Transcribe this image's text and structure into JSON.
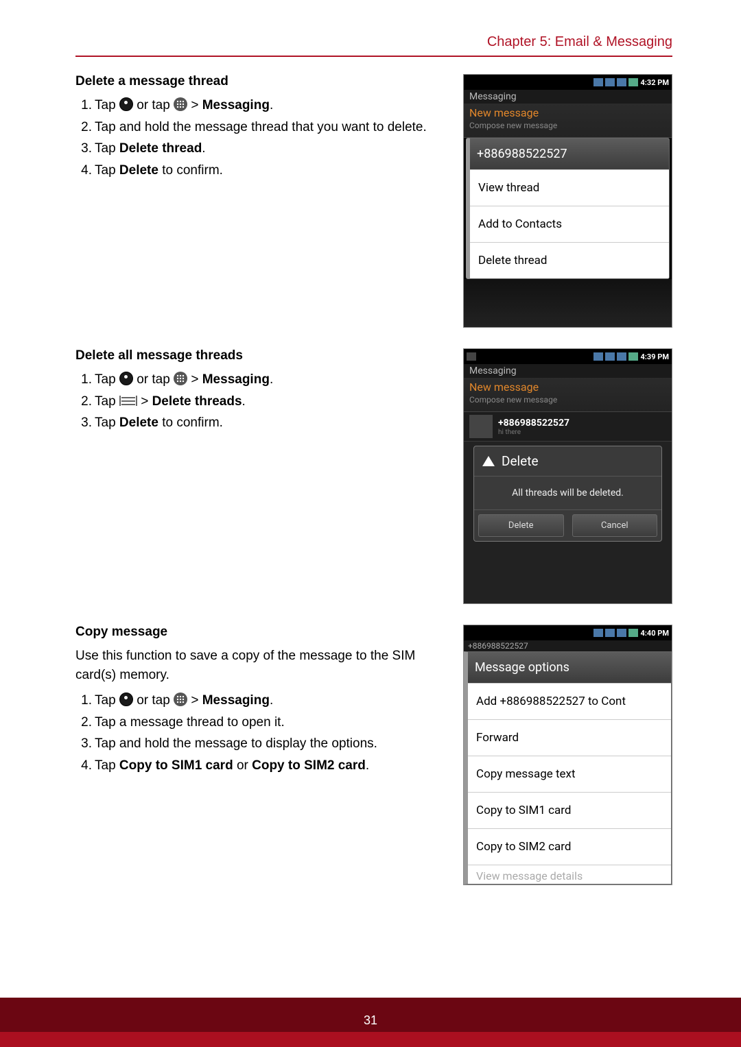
{
  "chapter": "Chapter 5: Email & Messaging",
  "page_number": "31",
  "sec1": {
    "heading": "Delete a message thread",
    "step1_a": "Tap ",
    "step1_b": " or tap ",
    "step1_c": "  > ",
    "step1_target": "Messaging",
    "step1_end": ".",
    "step2": "Tap and hold the message thread that you want to delete.",
    "step3_a": "Tap ",
    "step3_b": "Delete thread",
    "step3_c": ".",
    "step4_a": "Tap ",
    "step4_b": "Delete",
    "step4_c": " to confirm."
  },
  "sec2": {
    "heading": "Delete all message threads",
    "step1_a": "Tap ",
    "step1_b": " or tap ",
    "step1_c": "  > ",
    "step1_target": "Messaging",
    "step1_end": ".",
    "step2_a": "Tap ",
    "step2_b": " > ",
    "step2_target": "Delete threads",
    "step2_end": ".",
    "step3_a": "Tap ",
    "step3_b": "Delete",
    "step3_c": " to confirm."
  },
  "sec3": {
    "heading": "Copy message",
    "intro": "Use this function to save a copy of the message to the SIM card(s) memory.",
    "step1_a": "Tap ",
    "step1_b": " or tap ",
    "step1_c": "  > ",
    "step1_target": "Messaging",
    "step1_end": ".",
    "step2": "Tap a message thread to open it.",
    "step3": "Tap and hold the message to display the options.",
    "step4_a": "Tap ",
    "step4_b": "Copy to SIM1 card",
    "step4_c": " or ",
    "step4_d": "Copy to SIM2 card",
    "step4_e": "."
  },
  "screenshot1": {
    "time": "4:32 PM",
    "app_header": "Messaging",
    "newmsg": "New message",
    "newmsg_sub": "Compose new message",
    "ctx_header": "+886988522527",
    "item1": "View thread",
    "item2": "Add to Contacts",
    "item3": "Delete thread"
  },
  "screenshot2": {
    "time": "4:39 PM",
    "app_header": "Messaging",
    "newmsg": "New message",
    "newmsg_sub": "Compose new message",
    "thread_num": "+886988522527",
    "thread_sub": "hi there",
    "dlg_title": "Delete",
    "dlg_msg": "All threads will be deleted.",
    "btn_delete": "Delete",
    "btn_cancel": "Cancel"
  },
  "screenshot3": {
    "time": "4:40 PM",
    "header_num": "+886988522527",
    "ctx_header": "Message options",
    "item1": "Add +886988522527 to Cont",
    "item2": "Forward",
    "item3": "Copy message text",
    "item4": "Copy to SIM1 card",
    "item5": "Copy to SIM2 card",
    "item6": "View message details"
  }
}
